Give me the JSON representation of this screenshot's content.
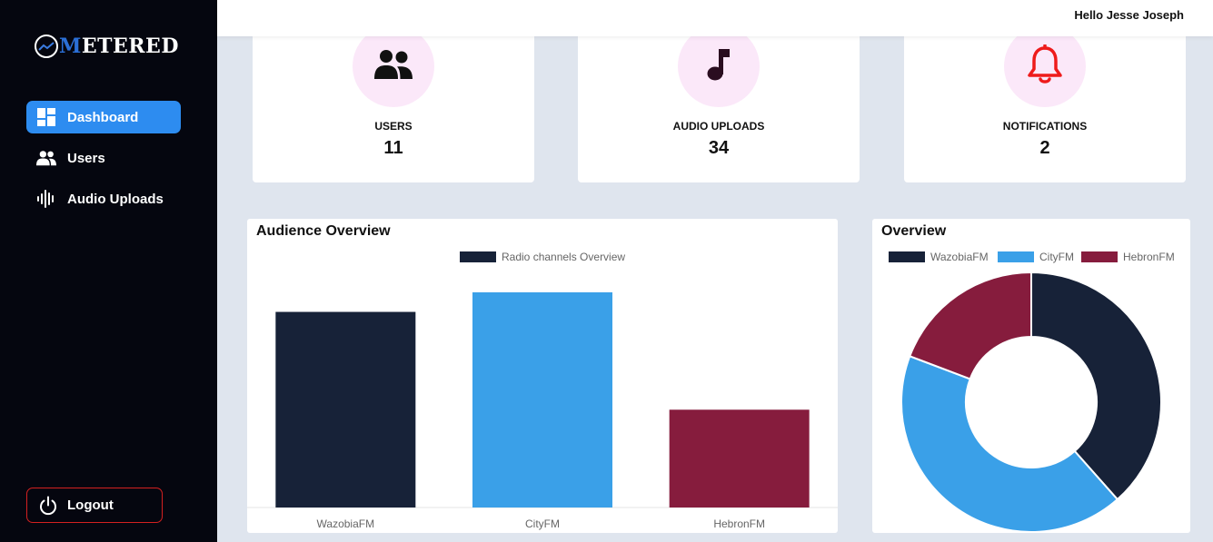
{
  "app": {
    "logo_text_first": "M",
    "logo_text_rest": "ETERED"
  },
  "sidebar": {
    "items": [
      {
        "label": "Dashboard",
        "icon": "dashboard-icon",
        "active": true
      },
      {
        "label": "Users",
        "icon": "users-icon",
        "active": false
      },
      {
        "label": "Audio Uploads",
        "icon": "audio-wave-icon",
        "active": false
      }
    ],
    "logout_label": "Logout"
  },
  "header": {
    "greeting": "Hello Jesse Joseph"
  },
  "stats": [
    {
      "label": "USERS",
      "value": "11",
      "icon": "users-icon"
    },
    {
      "label": "AUDIO UPLOADS",
      "value": "34",
      "icon": "music-note-icon"
    },
    {
      "label": "NOTIFICATIONS",
      "value": "2",
      "icon": "bell-icon"
    }
  ],
  "colors": {
    "wazobia": "#172238",
    "city": "#3aa0e8",
    "hebron": "#861c3d",
    "accent": "#2d8cf0",
    "icon_bg": "#fbe8f9",
    "bell": "#ee1b1b"
  },
  "chart_data": [
    {
      "type": "bar",
      "title": "Audience Overview",
      "legend": [
        "Radio channels Overview"
      ],
      "categories": [
        "WazobiaFM",
        "CityFM",
        "HebronFM"
      ],
      "values": [
        10,
        11,
        5
      ],
      "ylim": [
        0,
        11
      ],
      "grid": false,
      "legend_position": "top"
    },
    {
      "type": "pie",
      "title": "Overview",
      "labels": [
        "WazobiaFM",
        "CityFM",
        "HebronFM"
      ],
      "values": [
        10,
        11,
        5
      ],
      "legend_position": "top"
    }
  ]
}
